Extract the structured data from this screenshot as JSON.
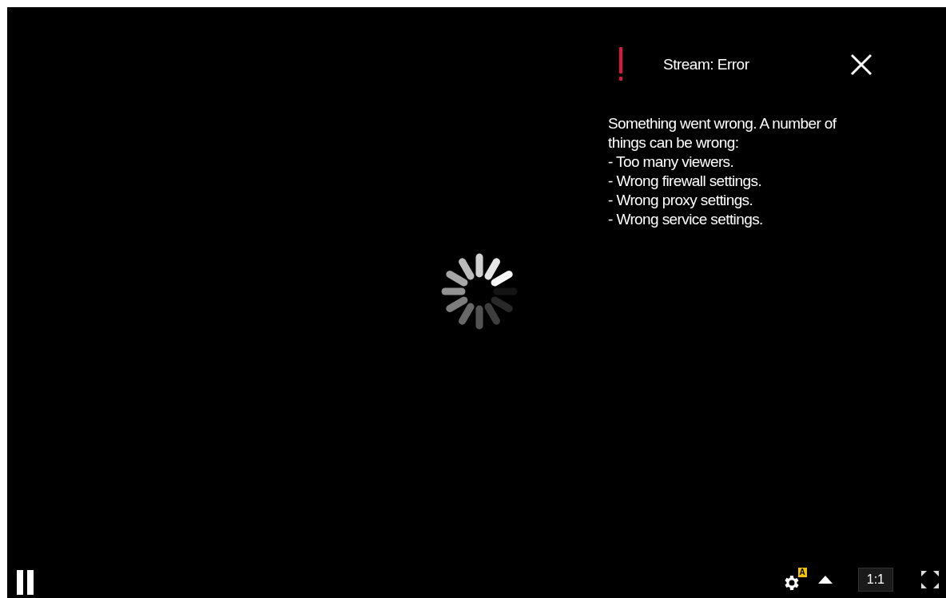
{
  "error_panel": {
    "title": "Stream: Error",
    "message": "Something went wrong. A number of things can be wrong:",
    "reasons": [
      "- Too many viewers.",
      "- Wrong firewall settings.",
      "- Wrong proxy settings.",
      "- Wrong service settings."
    ]
  },
  "player": {
    "loading": true,
    "paused": false
  },
  "controls": {
    "settings_badge": "A",
    "zoom_label": "1:1"
  }
}
